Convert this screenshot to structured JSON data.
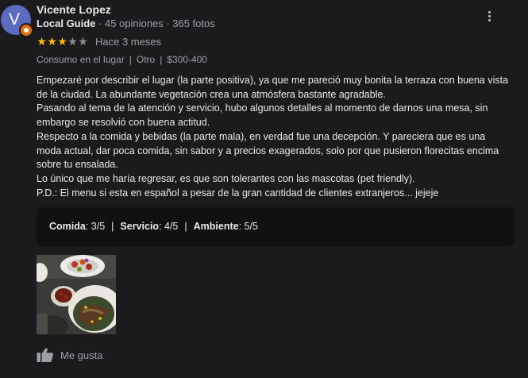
{
  "reviewer": {
    "initial": "V",
    "name": "Vicente Lopez",
    "badge": "Local Guide",
    "stats": "· 45 opiniones · 365 fotos"
  },
  "rating": {
    "stars": 3,
    "max": 5,
    "date": "Hace 3 meses"
  },
  "attributes": [
    "Consumo en el lugar",
    "Otro",
    "$300-400"
  ],
  "body": [
    "Empezaré por describir el lugar (la parte positiva), ya que me pareció muy bonita la terraza con buena vista de la ciudad. La abundante vegetación crea una atmósfera bastante agradable.",
    "Pasando al tema de la atención y servicio, hubo algunos detalles al momento de darnos una mesa, sin embargo se resolvió con buena actitud.",
    "Respecto a la comida y bebidas (la parte mala), en verdad fue una decepción. Y pareciera que es una moda actual, dar poca comida, sin sabor y a precios exagerados, solo por que pusieron florecitas encima sobre tu ensalada.",
    "Lo único que me haría regresar, es que son tolerantes con las mascotas (pet friendly).",
    "P.D.: El menu si esta en español a pesar de la gran cantidad de clientes extranjeros... jejeje"
  ],
  "scores": {
    "food_label": "Comida",
    "food_value": ": 3/5",
    "service_label": "Servicio",
    "service_value": ": 4/5",
    "ambience_label": "Ambiente",
    "ambience_value": ": 5/5",
    "separator": "|"
  },
  "actions": {
    "like_label": "Me gusta"
  },
  "icons": {
    "more": "more-vert-icon",
    "like": "thumb-up-icon",
    "badge": "local-guide-badge-icon"
  },
  "colors": {
    "avatar": "#5c6bc0",
    "badge": "#e8710a",
    "star_on": "#fbbc04",
    "star_off": "#8a8d91",
    "background": "#1b1b1d"
  }
}
